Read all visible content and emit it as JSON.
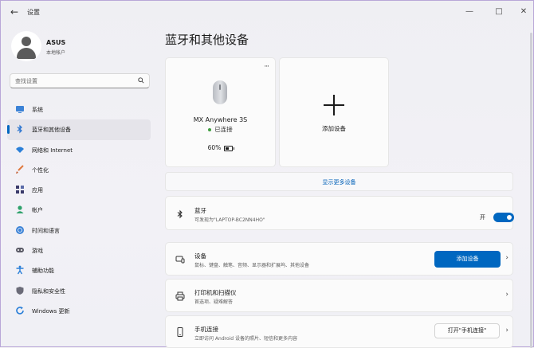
{
  "window": {
    "title": "设置",
    "back_icon": "back-arrow-icon"
  },
  "profile": {
    "name": "ASUS",
    "subtitle": "本地帐户"
  },
  "search": {
    "placeholder": "查找设置"
  },
  "sidebar": {
    "items": [
      {
        "label": "系统",
        "icon": "system-icon",
        "color": "#3b82d6",
        "active": false
      },
      {
        "label": "蓝牙和其他设备",
        "icon": "bluetooth-icon",
        "color": "#3b82d6",
        "active": true
      },
      {
        "label": "网络和 Internet",
        "icon": "wifi-icon",
        "color": "#2a7fd8",
        "active": false
      },
      {
        "label": "个性化",
        "icon": "brush-icon",
        "color": "#e0793e",
        "active": false
      },
      {
        "label": "应用",
        "icon": "apps-icon",
        "color": "#3a3a6a",
        "active": false
      },
      {
        "label": "帐户",
        "icon": "account-icon",
        "color": "#2fa26b",
        "active": false
      },
      {
        "label": "时间和语言",
        "icon": "globe-clock-icon",
        "color": "#3b82d6",
        "active": false
      },
      {
        "label": "游戏",
        "icon": "gamepad-icon",
        "color": "#5a5a66",
        "active": false
      },
      {
        "label": "辅助功能",
        "icon": "accessibility-icon",
        "color": "#2a7fd8",
        "active": false
      },
      {
        "label": "隐私和安全性",
        "icon": "shield-icon",
        "color": "#6b6b78",
        "active": false
      },
      {
        "label": "Windows 更新",
        "icon": "update-icon",
        "color": "#2a7fd8",
        "active": false
      }
    ]
  },
  "main": {
    "title": "蓝牙和其他设备",
    "device": {
      "name": "MX Anywhere 3S",
      "status": "已连接",
      "battery": "60%",
      "more": "···"
    },
    "add_device_card": {
      "label": "添加设备"
    },
    "show_more": "显示更多设备",
    "bluetooth": {
      "title": "蓝牙",
      "subtitle": "可发现为\"LAPTOP-BC2NN4HO\"",
      "toggle_label": "开",
      "toggle_on": true
    },
    "devices_row": {
      "title": "设备",
      "subtitle": "鼠标、键盘、触笔、音频、显示器和扩展坞、其他设备",
      "button": "添加设备"
    },
    "printers_row": {
      "title": "打印机和扫描仪",
      "subtitle": "首选项、疑难解答"
    },
    "phone_row": {
      "title": "手机连接",
      "subtitle": "立即访问 Android 设备的照片、短信和更多内容",
      "button": "打开\"手机连接\""
    }
  },
  "colors": {
    "accent": "#0067c0",
    "link": "#0060b8"
  }
}
